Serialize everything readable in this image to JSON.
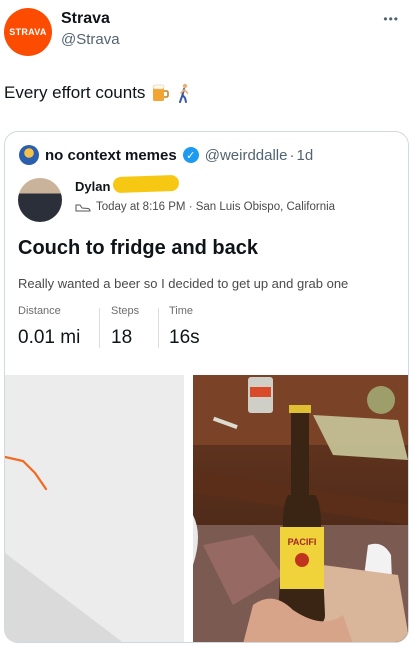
{
  "tweet": {
    "author_avatar_text": "STRAVA",
    "author_name": "Strava",
    "author_handle": "@Strava",
    "more_icon": "more-icon",
    "text": "Every effort counts",
    "emojis": [
      "beer-mug-icon",
      "person-walking-icon"
    ]
  },
  "quoted": {
    "name": "no context memes",
    "handle": "@weirddalle",
    "separator": "·",
    "age": "1d",
    "activity": {
      "athlete_name": "Dylan",
      "meta_icon": "shoe-icon",
      "meta_text": "Today at 8:16 PM · San Luis Obispo, California",
      "title": "Couch to fridge and back",
      "description": "Really wanted a beer so I decided to get up and grab one",
      "stats": [
        {
          "label": "Distance",
          "value": "0.01 mi"
        },
        {
          "label": "Steps",
          "value": "18"
        },
        {
          "label": "Time",
          "value": "16s"
        }
      ]
    },
    "photo_bottle_label": "PACIFI"
  },
  "colors": {
    "strava_orange": "#fc4c02",
    "verified_blue": "#1d9bf0",
    "handle_gray": "#536471",
    "route_orange": "#f26a21"
  }
}
